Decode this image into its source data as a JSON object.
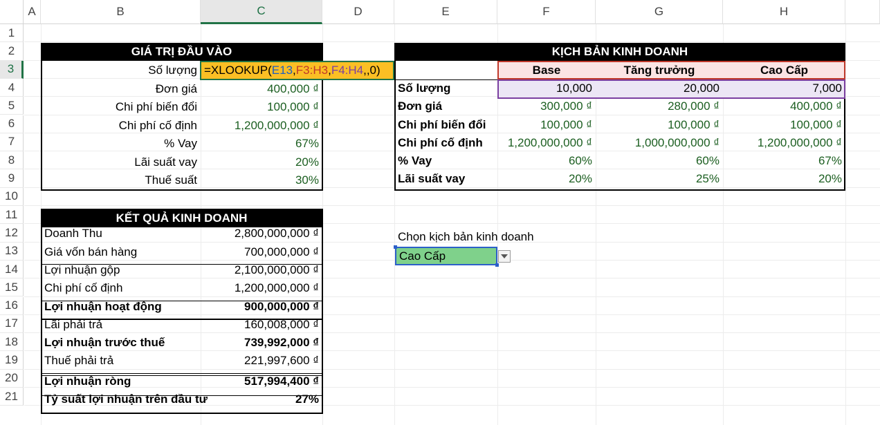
{
  "columns": [
    "A",
    "B",
    "C",
    "D",
    "E",
    "F",
    "G",
    "H"
  ],
  "rows": [
    "1",
    "2",
    "3",
    "4",
    "5",
    "6",
    "7",
    "8",
    "9",
    "10",
    "11",
    "12",
    "13",
    "14",
    "15",
    "16",
    "17",
    "18",
    "19",
    "20",
    "21"
  ],
  "formula": {
    "eq": "=XLOOKUP(",
    "arg1": "E13",
    "sep1": ",",
    "arg2": "F3:H3",
    "sep2": ",",
    "arg3": "F4:H4",
    "tail": ",,0)"
  },
  "inputs": {
    "title": "GIÁ TRỊ ĐẦU VÀO",
    "rows": [
      {
        "label": "Số lượng",
        "value": ""
      },
      {
        "label": "Đơn giá",
        "value": "400,000 ₫"
      },
      {
        "label": "Chi phí biến đổi",
        "value": "100,000 ₫"
      },
      {
        "label": "Chi phí cố định",
        "value": "1,200,000,000 ₫"
      },
      {
        "label": "% Vay",
        "value": "67%"
      },
      {
        "label": "Lãi suất vay",
        "value": "20%"
      },
      {
        "label": "Thuế suất",
        "value": "30%"
      }
    ]
  },
  "scenarios": {
    "title": "KỊCH BẢN KINH DOANH",
    "headers": [
      "Base",
      "Tăng trưởng",
      "Cao Cấp"
    ],
    "rows": [
      {
        "label": "Số lượng",
        "values": [
          "10,000",
          "20,000",
          "7,000"
        ]
      },
      {
        "label": "Đơn giá",
        "values": [
          "300,000 ₫",
          "280,000 ₫",
          "400,000 ₫"
        ]
      },
      {
        "label": "Chi phí biến đổi",
        "values": [
          "100,000 ₫",
          "100,000 ₫",
          "100,000 ₫"
        ]
      },
      {
        "label": "Chi phí cố định",
        "values": [
          "1,200,000,000 ₫",
          "1,000,000,000 ₫",
          "1,200,000,000 ₫"
        ]
      },
      {
        "label": "% Vay",
        "values": [
          "60%",
          "60%",
          "67%"
        ]
      },
      {
        "label": "Lãi suất vay",
        "values": [
          "20%",
          "25%",
          "20%"
        ]
      }
    ]
  },
  "results": {
    "title": "KẾT QUẢ KINH DOANH",
    "rows": [
      {
        "label": "Doanh Thu",
        "value": "2,800,000,000 ₫"
      },
      {
        "label": "Giá vốn bán hàng",
        "value": "700,000,000 ₫"
      },
      {
        "label": "Lợi nhuận gộp",
        "value": "2,100,000,000 ₫"
      },
      {
        "label": "Chi phí cố định",
        "value": "1,200,000,000 ₫"
      },
      {
        "label": "Lợi nhuận hoạt động",
        "value": "900,000,000 ₫"
      },
      {
        "label": "Lãi phải trả",
        "value": "160,008,000 ₫"
      },
      {
        "label": "Lợi nhuận trước thuế",
        "value": "739,992,000 ₫"
      },
      {
        "label": "Thuế phải trả",
        "value": "221,997,600 ₫"
      },
      {
        "label": "Lợi nhuận ròng",
        "value": "517,994,400 ₫"
      },
      {
        "label": "Tỷ suất lợi nhuận trên đầu tư",
        "value": "27%"
      }
    ]
  },
  "selector": {
    "label": "Chọn kịch bản kinh doanh",
    "value": "Cao Cấp"
  }
}
